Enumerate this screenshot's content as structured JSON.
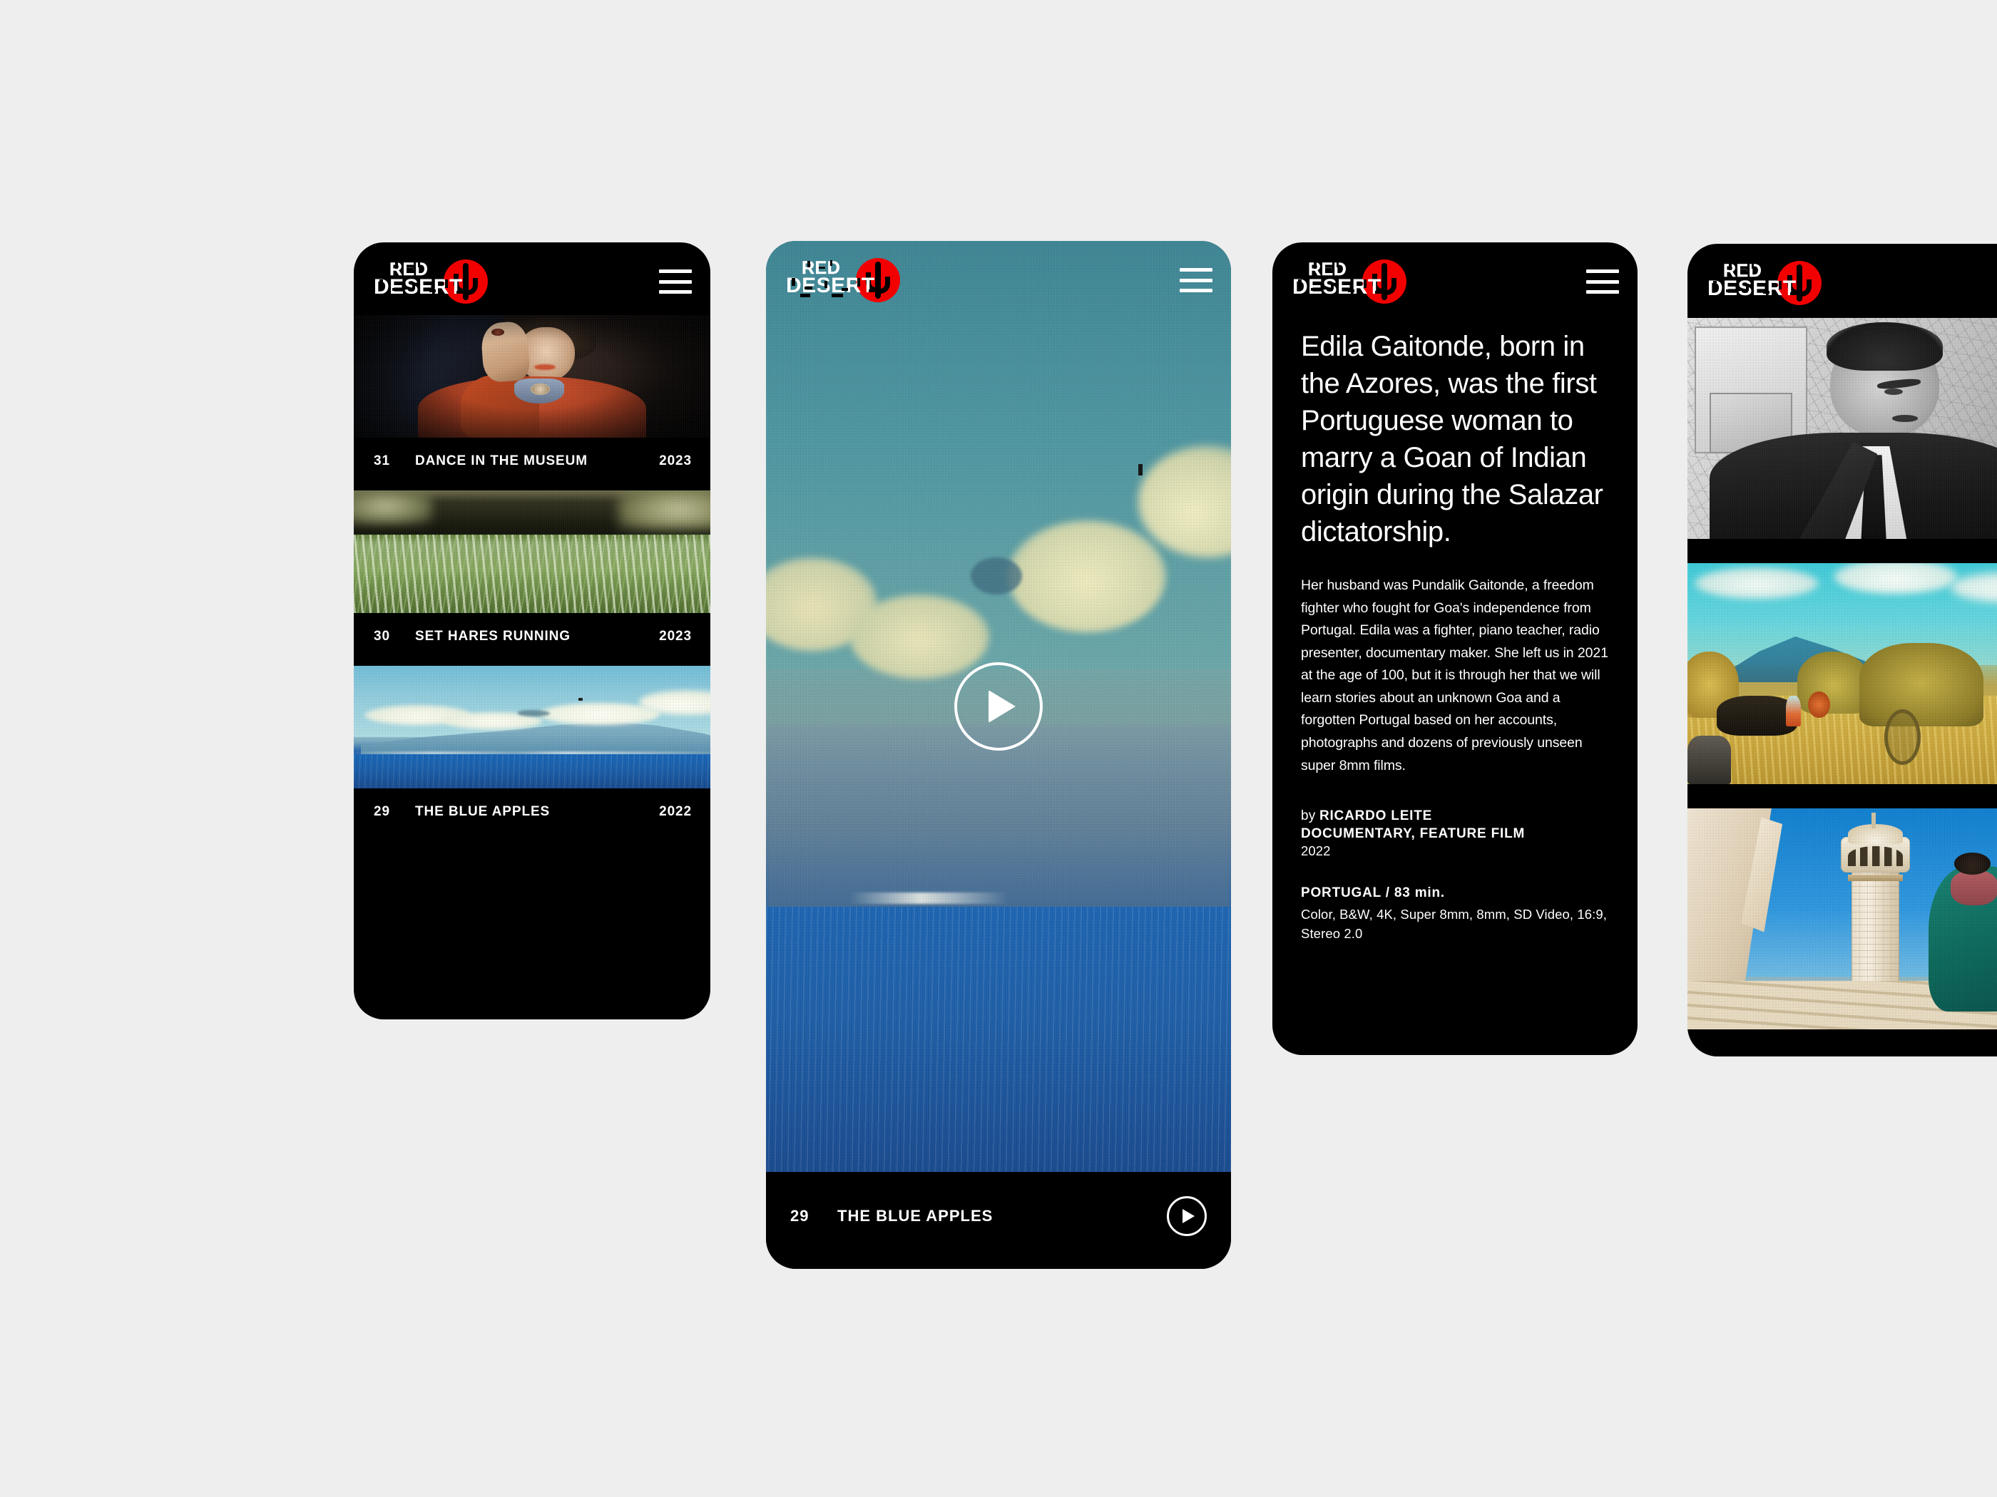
{
  "brand": {
    "name_line1": "RED",
    "name_line2": "DESERT",
    "logo_icon": "cactus-in-red-circle",
    "accent_color": "#f20000",
    "background_color": "#eeeeee",
    "surface_color": "#000000"
  },
  "nav": {
    "menu_icon": "hamburger-icon",
    "menu_label": "Menu"
  },
  "screens": {
    "catalogue": {
      "items": [
        {
          "number": "31",
          "title": "DANCE IN THE MUSEUM",
          "year": "2023",
          "thumb": "woman-in-rust-jacket"
        },
        {
          "number": "30",
          "title": "SET HARES RUNNING",
          "year": "2023",
          "thumb": "green-grass-field"
        },
        {
          "number": "29",
          "title": "THE BLUE APPLES",
          "year": "2022",
          "thumb": "azores-island-seascape"
        }
      ]
    },
    "player": {
      "number": "29",
      "title": "THE BLUE APPLES",
      "play_icon": "play-icon",
      "play_small_icon": "play-circle-icon",
      "frame": "azores-island-seascape"
    },
    "detail": {
      "lead": "Edila Gaitonde, born in the Azores, was the first Portuguese woman to marry a Goan of Indian origin during the Salazar dictatorship.",
      "paragraph": "Her husband was Pundalik Gaitonde, a freedom fighter who fought for Goa's independence from Portugal. Edila was a fighter, piano teacher, radio presenter, documentary maker. She left us in 2021 at the age of 100, but it is through her that we will learn stories about an unknown Goa and a forgotten Portugal based on her accounts, photographs and dozens of previously unseen super 8mm films.",
      "by_prefix": "by",
      "director": "RICARDO LEITE",
      "genre": "DOCUMENTARY, FEATURE FILM",
      "year": "2022",
      "origin": "PORTUGAL / 83 min.",
      "specs": "Color, B&W, 4K, Super 8mm, 8mm, SD Video, 16:9, Stereo 2.0"
    },
    "gallery": {
      "shots": [
        {
          "caption": "man-in-suit-before-map-bw"
        },
        {
          "caption": "harvest-field-haystacks"
        },
        {
          "caption": "taj-mahal-minaret-woman-in-sari"
        }
      ]
    }
  }
}
